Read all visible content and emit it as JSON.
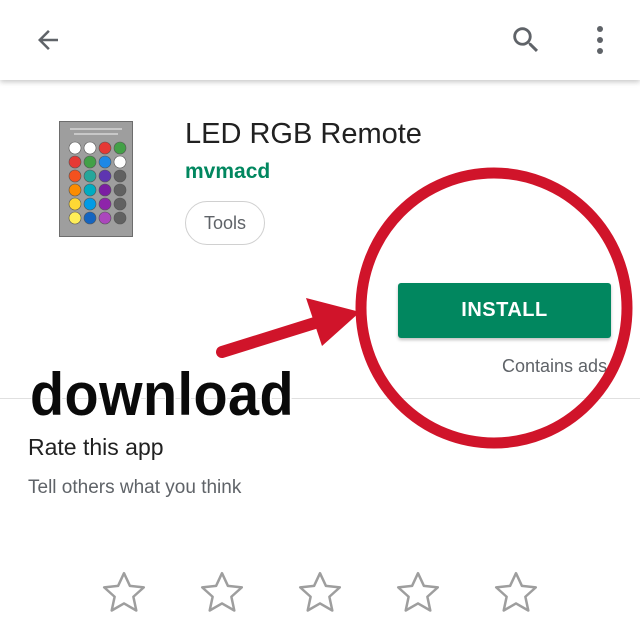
{
  "header": {
    "back_icon": "arrow-left-icon",
    "search_icon": "search-icon",
    "more_icon": "more-vert-icon"
  },
  "app": {
    "title": "LED RGB Remote",
    "developer": "mvmacd",
    "category": "Tools",
    "install_label": "INSTALL",
    "ads_note": "Contains ads"
  },
  "overlay": {
    "download_text": "download"
  },
  "rating": {
    "title": "Rate this app",
    "subtitle": "Tell others what you think",
    "star_icon": "star-outline-icon",
    "stars_count": 5,
    "selected_stars": 0
  },
  "colors": {
    "accent_green": "#01875f",
    "annotation_red": "#d0142a"
  }
}
